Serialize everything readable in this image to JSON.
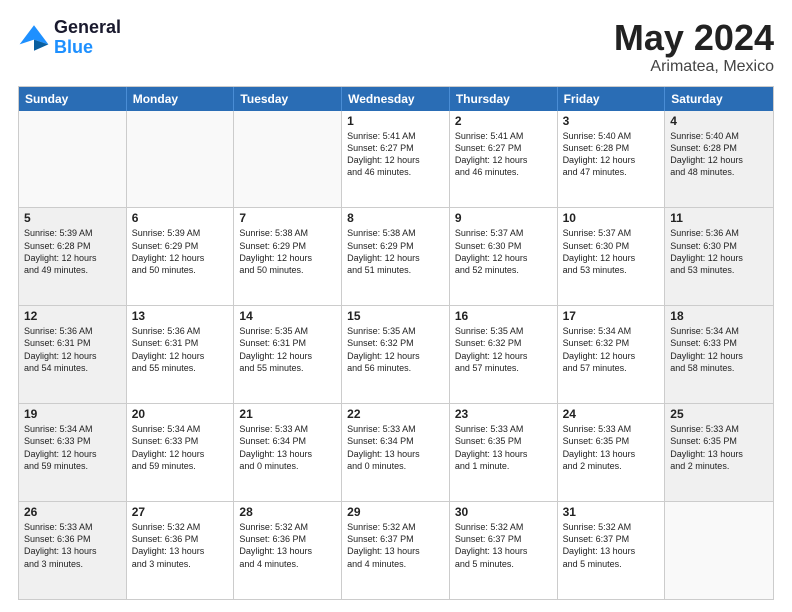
{
  "header": {
    "logo_line1": "General",
    "logo_line2": "Blue",
    "main_title": "May 2024",
    "subtitle": "Arimatea, Mexico"
  },
  "days_of_week": [
    "Sunday",
    "Monday",
    "Tuesday",
    "Wednesday",
    "Thursday",
    "Friday",
    "Saturday"
  ],
  "weeks": [
    [
      {
        "day": "",
        "text": "",
        "empty": true
      },
      {
        "day": "",
        "text": "",
        "empty": true
      },
      {
        "day": "",
        "text": "",
        "empty": true
      },
      {
        "day": "1",
        "text": "Sunrise: 5:41 AM\nSunset: 6:27 PM\nDaylight: 12 hours\nand 46 minutes.",
        "empty": false
      },
      {
        "day": "2",
        "text": "Sunrise: 5:41 AM\nSunset: 6:27 PM\nDaylight: 12 hours\nand 46 minutes.",
        "empty": false
      },
      {
        "day": "3",
        "text": "Sunrise: 5:40 AM\nSunset: 6:28 PM\nDaylight: 12 hours\nand 47 minutes.",
        "empty": false
      },
      {
        "day": "4",
        "text": "Sunrise: 5:40 AM\nSunset: 6:28 PM\nDaylight: 12 hours\nand 48 minutes.",
        "empty": false
      }
    ],
    [
      {
        "day": "5",
        "text": "Sunrise: 5:39 AM\nSunset: 6:28 PM\nDaylight: 12 hours\nand 49 minutes.",
        "empty": false
      },
      {
        "day": "6",
        "text": "Sunrise: 5:39 AM\nSunset: 6:29 PM\nDaylight: 12 hours\nand 50 minutes.",
        "empty": false
      },
      {
        "day": "7",
        "text": "Sunrise: 5:38 AM\nSunset: 6:29 PM\nDaylight: 12 hours\nand 50 minutes.",
        "empty": false
      },
      {
        "day": "8",
        "text": "Sunrise: 5:38 AM\nSunset: 6:29 PM\nDaylight: 12 hours\nand 51 minutes.",
        "empty": false
      },
      {
        "day": "9",
        "text": "Sunrise: 5:37 AM\nSunset: 6:30 PM\nDaylight: 12 hours\nand 52 minutes.",
        "empty": false
      },
      {
        "day": "10",
        "text": "Sunrise: 5:37 AM\nSunset: 6:30 PM\nDaylight: 12 hours\nand 53 minutes.",
        "empty": false
      },
      {
        "day": "11",
        "text": "Sunrise: 5:36 AM\nSunset: 6:30 PM\nDaylight: 12 hours\nand 53 minutes.",
        "empty": false
      }
    ],
    [
      {
        "day": "12",
        "text": "Sunrise: 5:36 AM\nSunset: 6:31 PM\nDaylight: 12 hours\nand 54 minutes.",
        "empty": false
      },
      {
        "day": "13",
        "text": "Sunrise: 5:36 AM\nSunset: 6:31 PM\nDaylight: 12 hours\nand 55 minutes.",
        "empty": false
      },
      {
        "day": "14",
        "text": "Sunrise: 5:35 AM\nSunset: 6:31 PM\nDaylight: 12 hours\nand 55 minutes.",
        "empty": false
      },
      {
        "day": "15",
        "text": "Sunrise: 5:35 AM\nSunset: 6:32 PM\nDaylight: 12 hours\nand 56 minutes.",
        "empty": false
      },
      {
        "day": "16",
        "text": "Sunrise: 5:35 AM\nSunset: 6:32 PM\nDaylight: 12 hours\nand 57 minutes.",
        "empty": false
      },
      {
        "day": "17",
        "text": "Sunrise: 5:34 AM\nSunset: 6:32 PM\nDaylight: 12 hours\nand 57 minutes.",
        "empty": false
      },
      {
        "day": "18",
        "text": "Sunrise: 5:34 AM\nSunset: 6:33 PM\nDaylight: 12 hours\nand 58 minutes.",
        "empty": false
      }
    ],
    [
      {
        "day": "19",
        "text": "Sunrise: 5:34 AM\nSunset: 6:33 PM\nDaylight: 12 hours\nand 59 minutes.",
        "empty": false
      },
      {
        "day": "20",
        "text": "Sunrise: 5:34 AM\nSunset: 6:33 PM\nDaylight: 12 hours\nand 59 minutes.",
        "empty": false
      },
      {
        "day": "21",
        "text": "Sunrise: 5:33 AM\nSunset: 6:34 PM\nDaylight: 13 hours\nand 0 minutes.",
        "empty": false
      },
      {
        "day": "22",
        "text": "Sunrise: 5:33 AM\nSunset: 6:34 PM\nDaylight: 13 hours\nand 0 minutes.",
        "empty": false
      },
      {
        "day": "23",
        "text": "Sunrise: 5:33 AM\nSunset: 6:35 PM\nDaylight: 13 hours\nand 1 minute.",
        "empty": false
      },
      {
        "day": "24",
        "text": "Sunrise: 5:33 AM\nSunset: 6:35 PM\nDaylight: 13 hours\nand 2 minutes.",
        "empty": false
      },
      {
        "day": "25",
        "text": "Sunrise: 5:33 AM\nSunset: 6:35 PM\nDaylight: 13 hours\nand 2 minutes.",
        "empty": false
      }
    ],
    [
      {
        "day": "26",
        "text": "Sunrise: 5:33 AM\nSunset: 6:36 PM\nDaylight: 13 hours\nand 3 minutes.",
        "empty": false
      },
      {
        "day": "27",
        "text": "Sunrise: 5:32 AM\nSunset: 6:36 PM\nDaylight: 13 hours\nand 3 minutes.",
        "empty": false
      },
      {
        "day": "28",
        "text": "Sunrise: 5:32 AM\nSunset: 6:36 PM\nDaylight: 13 hours\nand 4 minutes.",
        "empty": false
      },
      {
        "day": "29",
        "text": "Sunrise: 5:32 AM\nSunset: 6:37 PM\nDaylight: 13 hours\nand 4 minutes.",
        "empty": false
      },
      {
        "day": "30",
        "text": "Sunrise: 5:32 AM\nSunset: 6:37 PM\nDaylight: 13 hours\nand 5 minutes.",
        "empty": false
      },
      {
        "day": "31",
        "text": "Sunrise: 5:32 AM\nSunset: 6:37 PM\nDaylight: 13 hours\nand 5 minutes.",
        "empty": false
      },
      {
        "day": "",
        "text": "",
        "empty": true
      }
    ]
  ]
}
